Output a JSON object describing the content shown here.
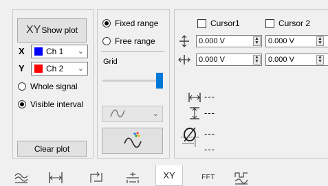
{
  "left": {
    "show_plot_prefix": "XY",
    "show_plot_label": "Show plot",
    "x_axis": {
      "letter": "X",
      "channel": "Ch 1",
      "color": "#0000ff"
    },
    "y_axis": {
      "letter": "Y",
      "channel": "Ch 2",
      "color": "#ff0000"
    },
    "whole_signal": "Whole signal",
    "visible_interval": "Visible interval",
    "clear_plot": "Clear plot"
  },
  "middle": {
    "fixed_range": "Fixed range",
    "free_range": "Free range",
    "grid_label": "Grid",
    "grid_level": 1.0
  },
  "right": {
    "cursor1": "Cursor1",
    "cursor2": "Cursor 2",
    "voltage": {
      "c1_v1": "0.000 V",
      "c2_v1": "0.000 V",
      "c1_v2": "0.000 V",
      "c2_v2": "0.000 V"
    },
    "measurements": [
      "---",
      "---",
      "---",
      "---"
    ]
  },
  "tabs": {
    "xy": "XY",
    "fft": "FFT"
  },
  "colors": {
    "accent": "#0078d7"
  }
}
